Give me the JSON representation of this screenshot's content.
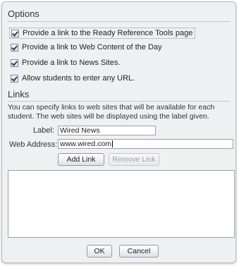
{
  "options": {
    "title": "Options",
    "checkboxes": [
      {
        "label": "Provide a link to the Ready Reference Tools page",
        "checked": true
      },
      {
        "label": "Provide a link to Web Content of the Day",
        "checked": true
      },
      {
        "label": "Provide a link to News Sites.",
        "checked": true
      },
      {
        "label": "Allow students to enter any URL.",
        "checked": true
      }
    ]
  },
  "links": {
    "title": "Links",
    "description": "You can specify links to web sites that will be available for each student. The web sites will be displayed using the label given.",
    "label_field": {
      "label": "Label:",
      "value": "Wired News"
    },
    "address_field": {
      "label": "Web Address:",
      "value": "www.wired.com"
    },
    "add_link_label": "Add Link",
    "remove_link_label": "Remove Link",
    "items": []
  },
  "buttons": {
    "ok_label": "OK",
    "cancel_label": "Cancel"
  }
}
